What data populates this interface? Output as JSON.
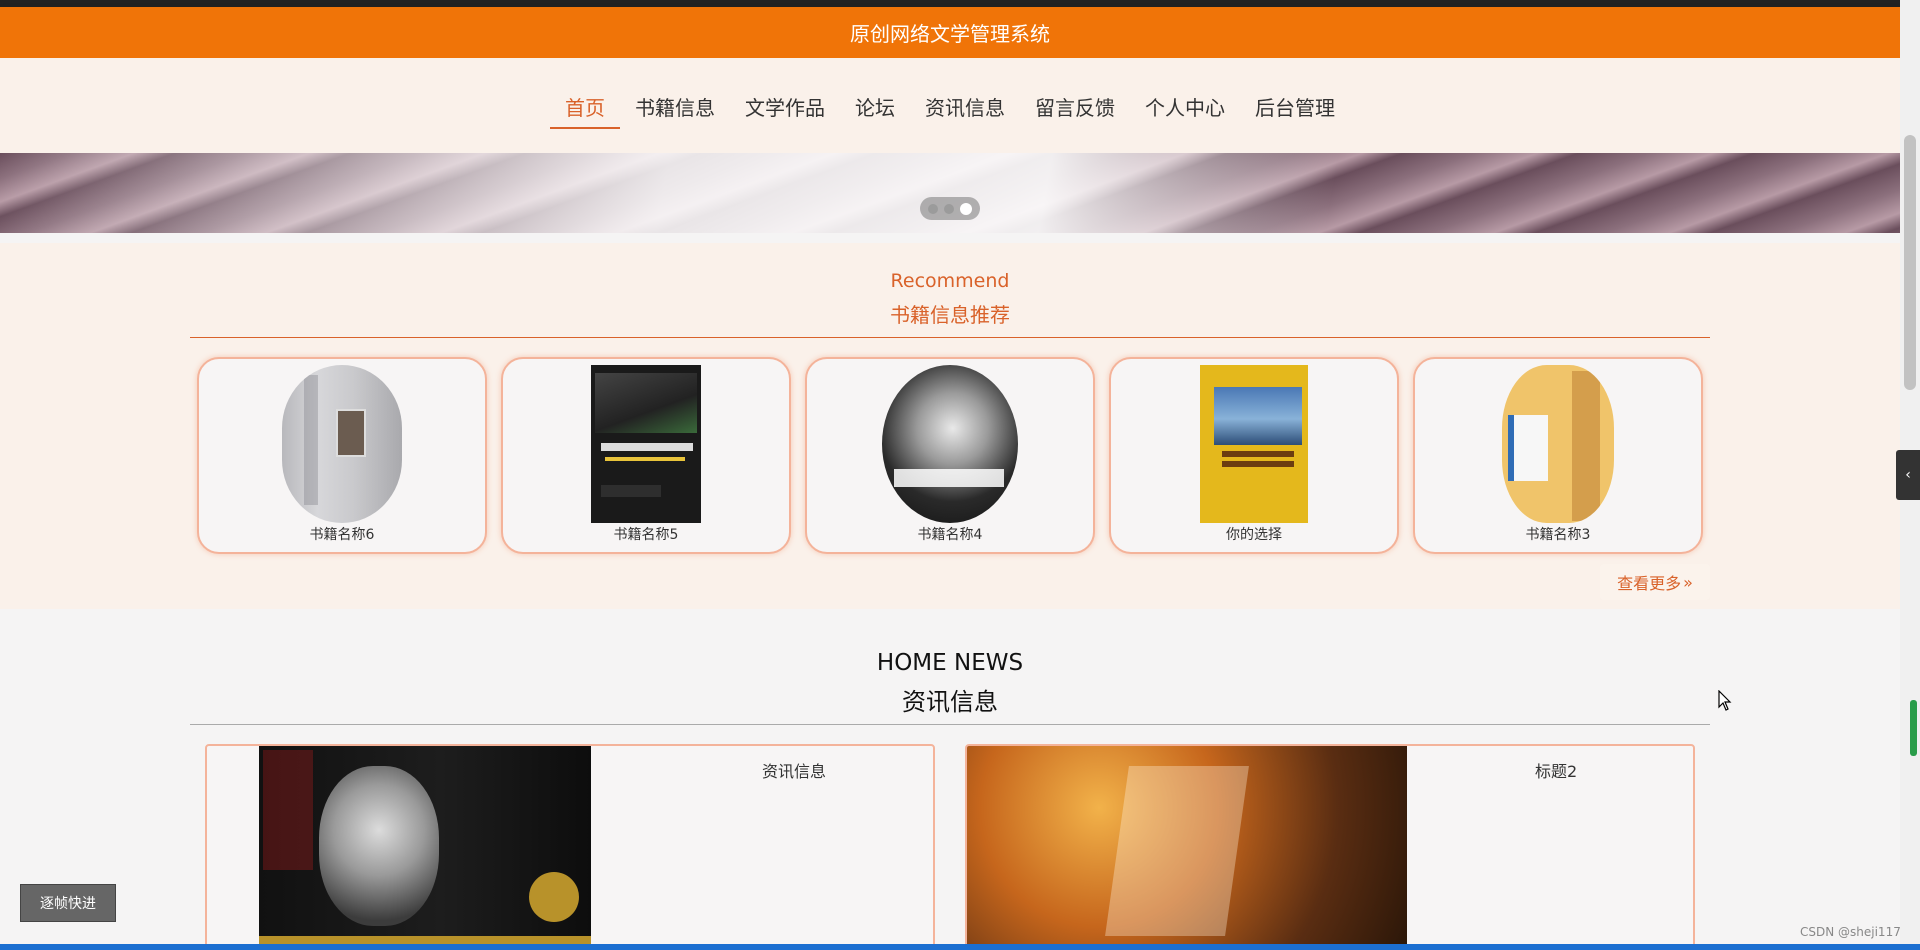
{
  "app": {
    "title": "原创网络文学管理系统"
  },
  "nav": {
    "items": [
      {
        "label": "首页",
        "active": true
      },
      {
        "label": "书籍信息"
      },
      {
        "label": "文学作品"
      },
      {
        "label": "论坛"
      },
      {
        "label": "资讯信息"
      },
      {
        "label": "留言反馈"
      },
      {
        "label": "个人中心"
      },
      {
        "label": "后台管理"
      }
    ]
  },
  "carousel": {
    "slides": 3,
    "active_index": 2
  },
  "recommend": {
    "title_en": "Recommend",
    "title_cn": "书籍信息推荐",
    "books": [
      {
        "title": "书籍名称6"
      },
      {
        "title": "书籍名称5"
      },
      {
        "title": "书籍名称4"
      },
      {
        "title": "你的选择"
      },
      {
        "title": "书籍名称3"
      }
    ],
    "more_label": "查看更多",
    "more_icon": "chevron-double-right-icon"
  },
  "news": {
    "title_en": "HOME NEWS",
    "title_cn": "资讯信息",
    "items": [
      {
        "title": "资讯信息"
      },
      {
        "title": "标题2"
      }
    ]
  },
  "floating_button": {
    "label": "逐帧快进"
  },
  "watermark": "CSDN @sheji117",
  "colors": {
    "header": "#f07408",
    "accent": "#d9622a",
    "section_bg": "#faf1ea"
  }
}
